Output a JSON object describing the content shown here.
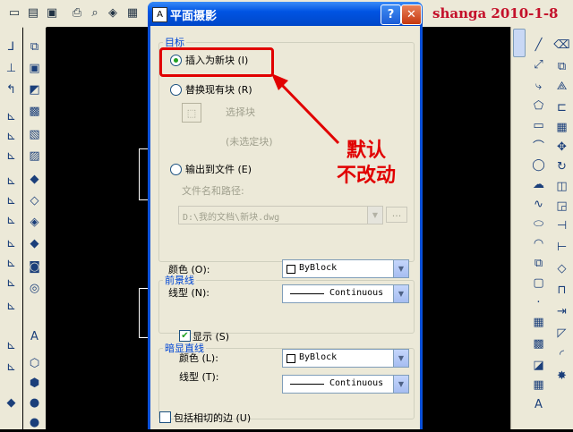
{
  "watermark": "shanga 2010-1-8",
  "dialog": {
    "title": "平面摄影",
    "help_label": "?",
    "close_label": "✕",
    "target": {
      "legend": "目标",
      "insert_new_block": "插入为新块 (I)",
      "replace_block": "替换现有块 (R)",
      "select_block": "选择块",
      "unselected_block": "(未选定块)",
      "export_file": "输出到文件 (E)",
      "file_path_label": "文件名和路径:",
      "file_path_value": "D:\\我的文档\\新块.dwg",
      "browse_label": "..."
    },
    "foreground": {
      "legend": "前景线",
      "color_label": "颜色 (O):",
      "color_value": "ByBlock",
      "linetype_label": "线型 (N):",
      "linetype_value": "Continuous"
    },
    "obscured": {
      "legend": "暗显直线",
      "show_label": "显示 (S)",
      "show_checked": true,
      "color_label": "颜色 (L):",
      "color_value": "ByBlock",
      "linetype_label": "线型 (T):",
      "linetype_value": "Continuous"
    },
    "tangent": {
      "label": "包括相切的边 (U)",
      "checked": false
    }
  },
  "annotation": {
    "line1": "默认",
    "line2": "不改动"
  },
  "colors": {
    "accent": "#0046d5",
    "annotation": "#e10000",
    "title_bar": "#0054e3"
  }
}
